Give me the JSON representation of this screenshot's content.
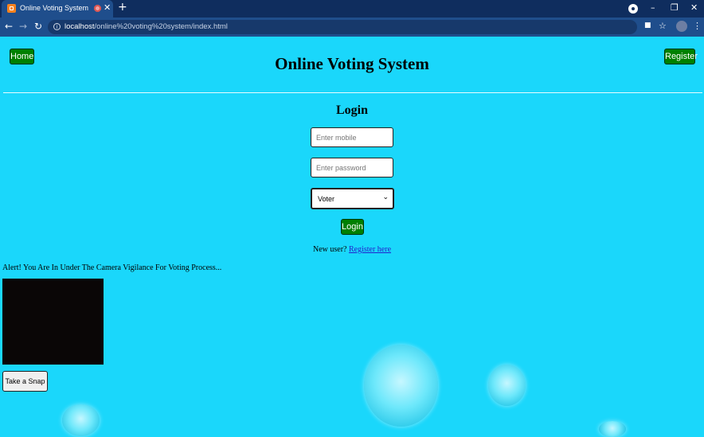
{
  "browser": {
    "tab_title": "Online Voting System",
    "url_host": "localhost",
    "url_path": "/online%20voting%20system/index.html"
  },
  "header": {
    "home_label": "Home",
    "title": "Online Voting System",
    "register_label": "Register"
  },
  "login": {
    "heading": "Login",
    "mobile_placeholder": "Enter mobile",
    "password_placeholder": "Enter password",
    "role_selected": "Voter",
    "button_label": "Login",
    "new_user_text": "New user?",
    "register_link": "Register here"
  },
  "camera": {
    "alert_text": "Alert! You Are In Under The Camera Vigilance For Voting Process...",
    "snap_label": "Take a Snap"
  },
  "colors": {
    "page_background": "#1ad7fb",
    "button_green": "#008000"
  }
}
